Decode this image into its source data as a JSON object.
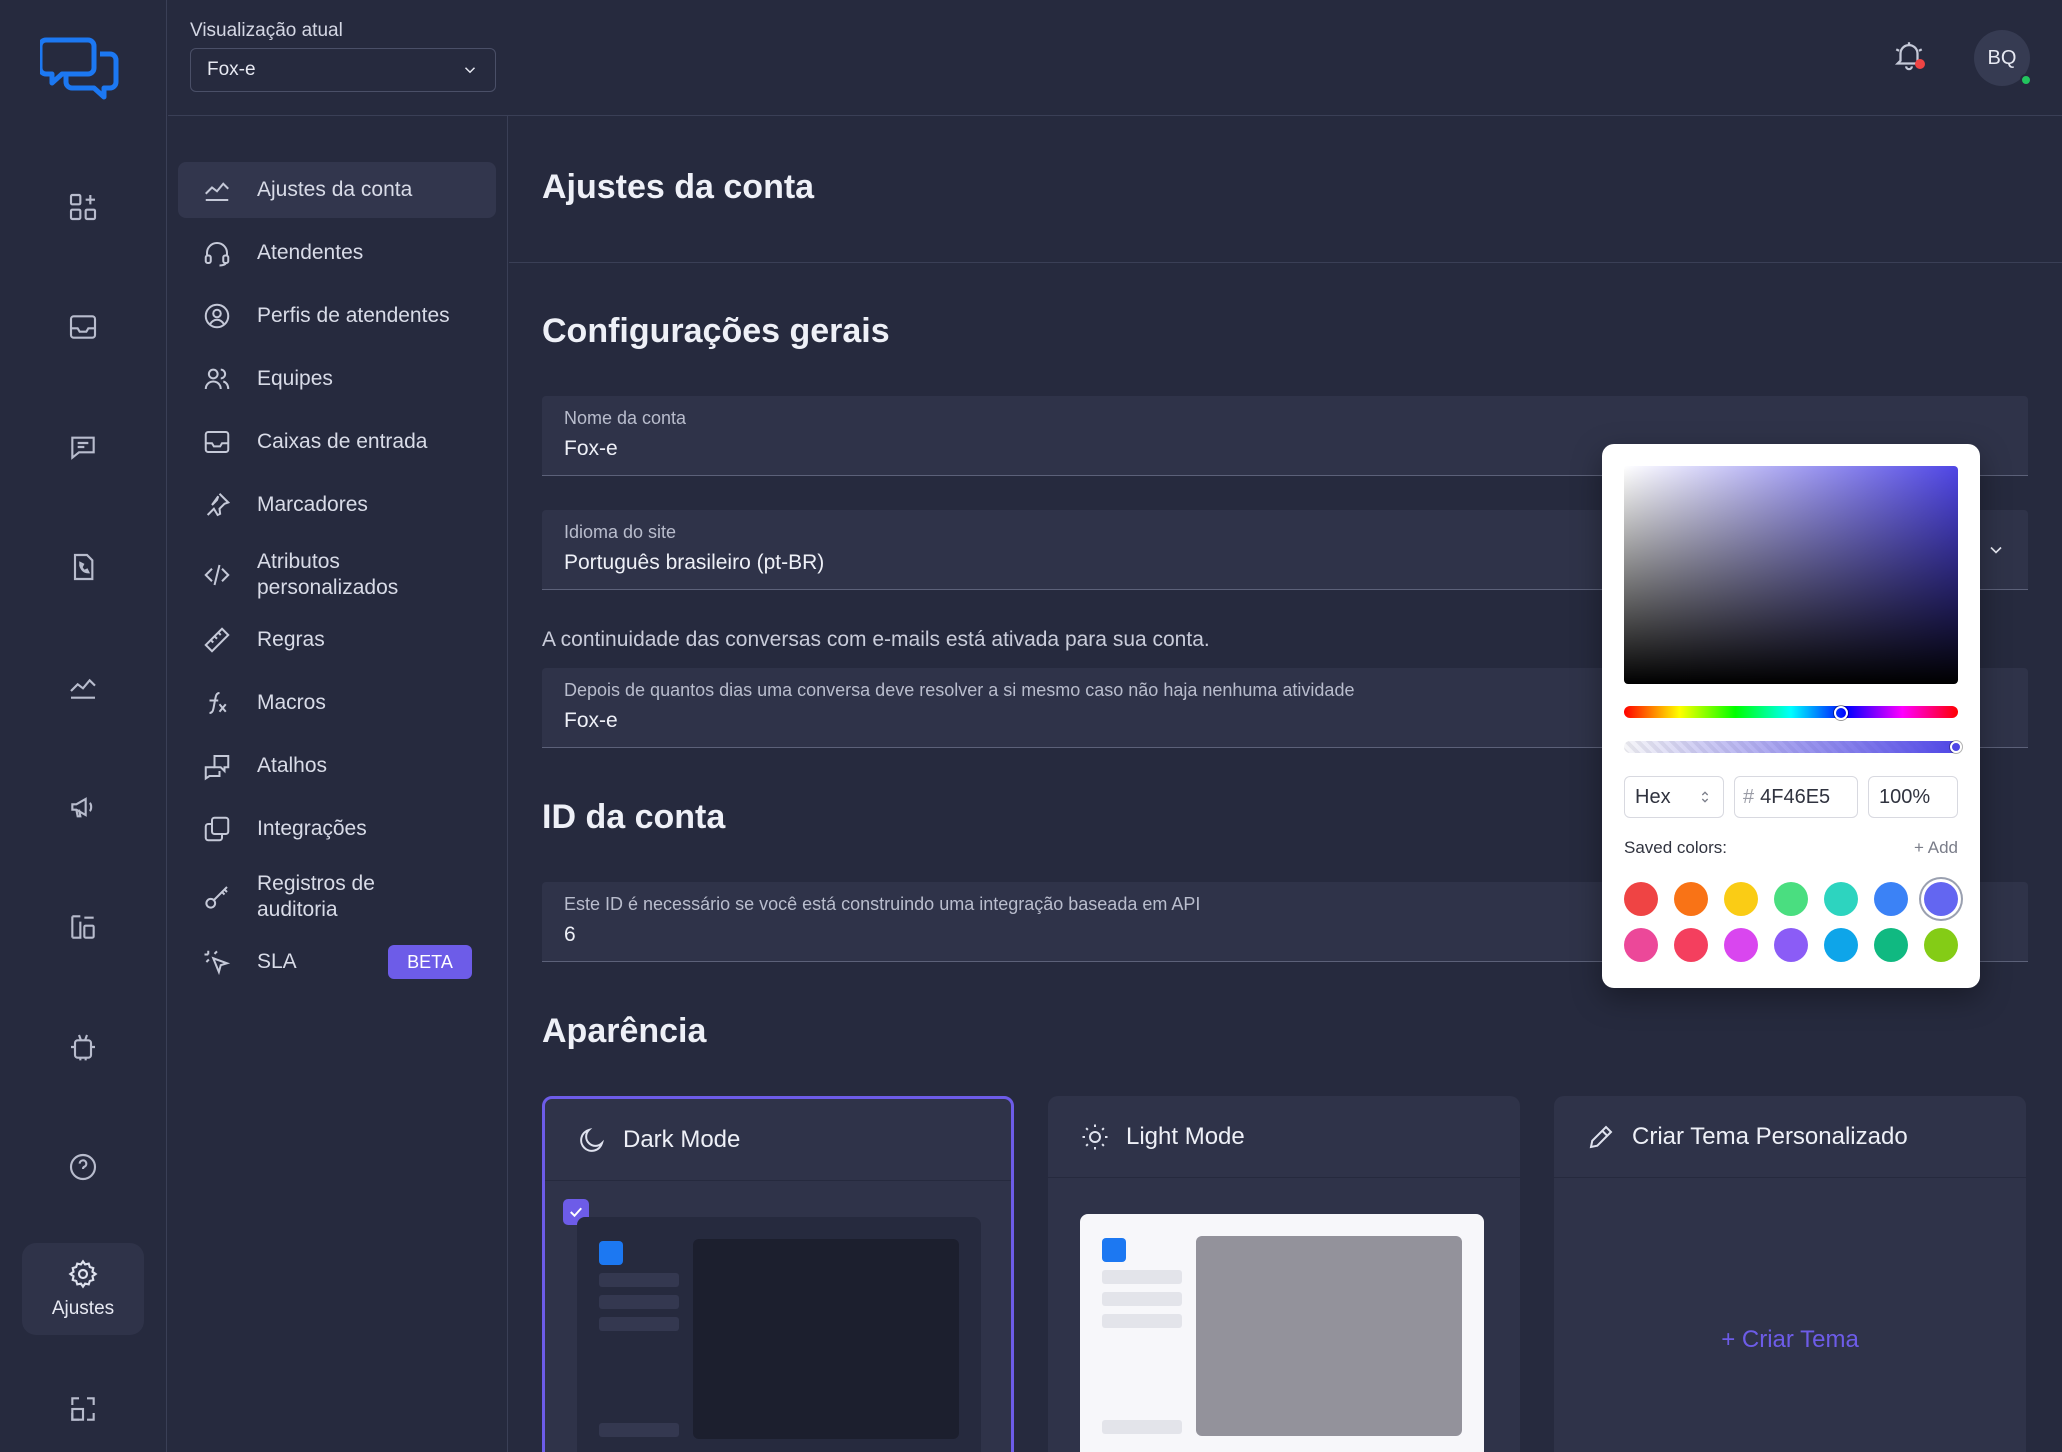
{
  "rail": {
    "settings_label": "Ajustes"
  },
  "topbar": {
    "view_label": "Visualização atual",
    "view_value": "Fox-e",
    "avatar_initials": "BQ"
  },
  "subnav": {
    "items": [
      {
        "label": "Ajustes da conta"
      },
      {
        "label": "Atendentes"
      },
      {
        "label": "Perfis de atendentes"
      },
      {
        "label": "Equipes"
      },
      {
        "label": "Caixas de entrada"
      },
      {
        "label": "Marcadores"
      },
      {
        "label": "Atributos personalizados"
      },
      {
        "label": "Regras"
      },
      {
        "label": "Macros"
      },
      {
        "label": "Atalhos"
      },
      {
        "label": "Integrações"
      },
      {
        "label": "Registros de auditoria"
      },
      {
        "label": "SLA",
        "badge": "BETA"
      }
    ]
  },
  "content": {
    "page_title": "Ajustes da conta",
    "general_title": "Configurações gerais",
    "account_name": {
      "label": "Nome da conta",
      "value": "Fox-e"
    },
    "site_language": {
      "label": "Idioma do site",
      "value": "Português brasileiro (pt-BR)"
    },
    "continuity_note": "A continuidade das conversas com e-mails está ativada para sua conta.",
    "auto_resolve": {
      "label": "Depois de quantos dias uma conversa deve resolver a si mesmo caso não haja nenhuma atividade",
      "value": "Fox-e"
    },
    "account_id_title": "ID da conta",
    "account_id": {
      "label": "Este ID é necessário se você está construindo uma integração baseada em API",
      "value": "6"
    },
    "appearance_title": "Aparência",
    "modes": {
      "dark": "Dark Mode",
      "light": "Light Mode",
      "custom": "Criar Tema Personalizado",
      "create_link": "+ Criar Tema"
    }
  },
  "picker": {
    "format": "Hex",
    "hex_value": "4F46E5",
    "hash": "#",
    "opacity": "100%",
    "saved_label": "Saved colors:",
    "add_label": "+ Add",
    "current_color": "#4f46e5",
    "hue_level": 0.65,
    "saved_colors": [
      "#ef4444",
      "#f97316",
      "#facc15",
      "#4ade80",
      "#2dd4bf",
      "#3b82f6",
      "#6366f1",
      "#ec4899",
      "#f43f5e",
      "#d946ef",
      "#8b5cf6",
      "#0ea5e9",
      "#10b981",
      "#84cc16"
    ],
    "selected_index": 6
  },
  "colors": {
    "accent": "#6d5ce8",
    "brand_blue": "#1c78f2",
    "background": "#262a3e"
  }
}
